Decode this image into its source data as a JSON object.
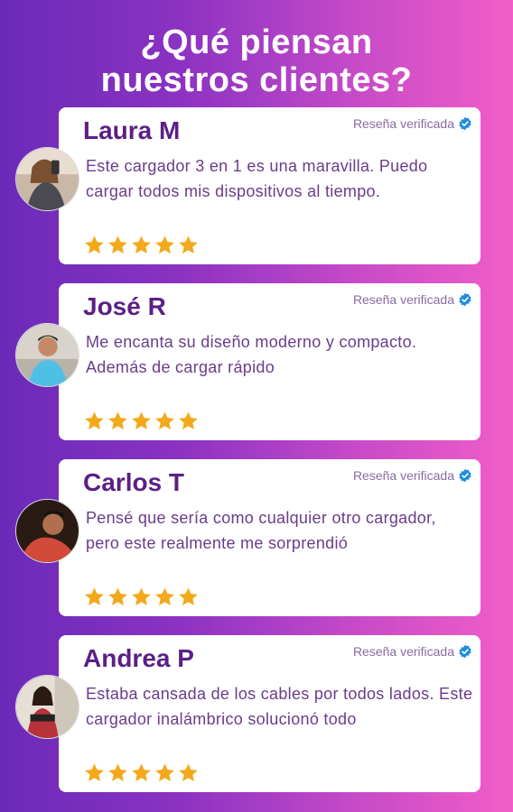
{
  "header": {
    "title_line1": "¿Qué piensan",
    "title_line2": "nuestros clientes?"
  },
  "colors": {
    "name": "#5b1f86",
    "text": "#6a3c8a",
    "star": "#f3a91c",
    "verified_badge": "#1e8ce0"
  },
  "reviews": [
    {
      "name": "Laura M",
      "badge": "Reseña verificada",
      "text": "Este cargador 3 en 1 es una maravilla. Puedo cargar todos mis dispositivos al tiempo.",
      "rating": 5
    },
    {
      "name": "José R",
      "badge": "Reseña verificada",
      "text": "Me encanta su diseño moderno y compacto. Además de cargar rápido",
      "rating": 5
    },
    {
      "name": "Carlos T",
      "badge": "Reseña verificada",
      "text": "Pensé que sería como cualquier otro cargador, pero este realmente me sorprendió",
      "rating": 5
    },
    {
      "name": "Andrea P",
      "badge": "Reseña verificada",
      "text": "Estaba cansada de los cables por todos lados. Este cargador inalámbrico solucionó todo",
      "rating": 5
    }
  ]
}
